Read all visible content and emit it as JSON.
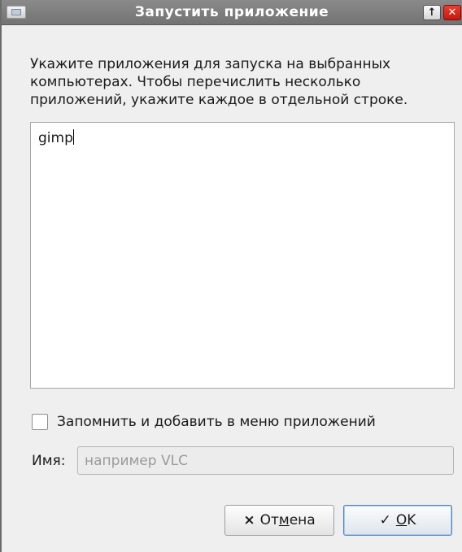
{
  "window": {
    "title": "Запустить приложение",
    "controls": {
      "up_glyph": "↑",
      "close_glyph": "✕"
    }
  },
  "description": "Укажите приложения для запуска на выбранных компьютерах. Чтобы перечислить несколько приложений, укажите каждое в отдельной строке.",
  "apps_text": "gimp",
  "remember": {
    "label": "Запомнить и добавить в меню приложений",
    "checked": false
  },
  "name_field": {
    "label": "Имя:",
    "placeholder": "например VLC",
    "value": ""
  },
  "buttons": {
    "cancel": {
      "icon": "×",
      "label_pre": "От",
      "label_mnemonic": "м",
      "label_post": "ена"
    },
    "ok": {
      "icon": "✓",
      "label_mnemonic": "O",
      "label_post": "K"
    }
  },
  "colors": {
    "titlebar": "#7d7d7d",
    "close_button": "#d9281c",
    "ok_border": "#4f85be"
  }
}
